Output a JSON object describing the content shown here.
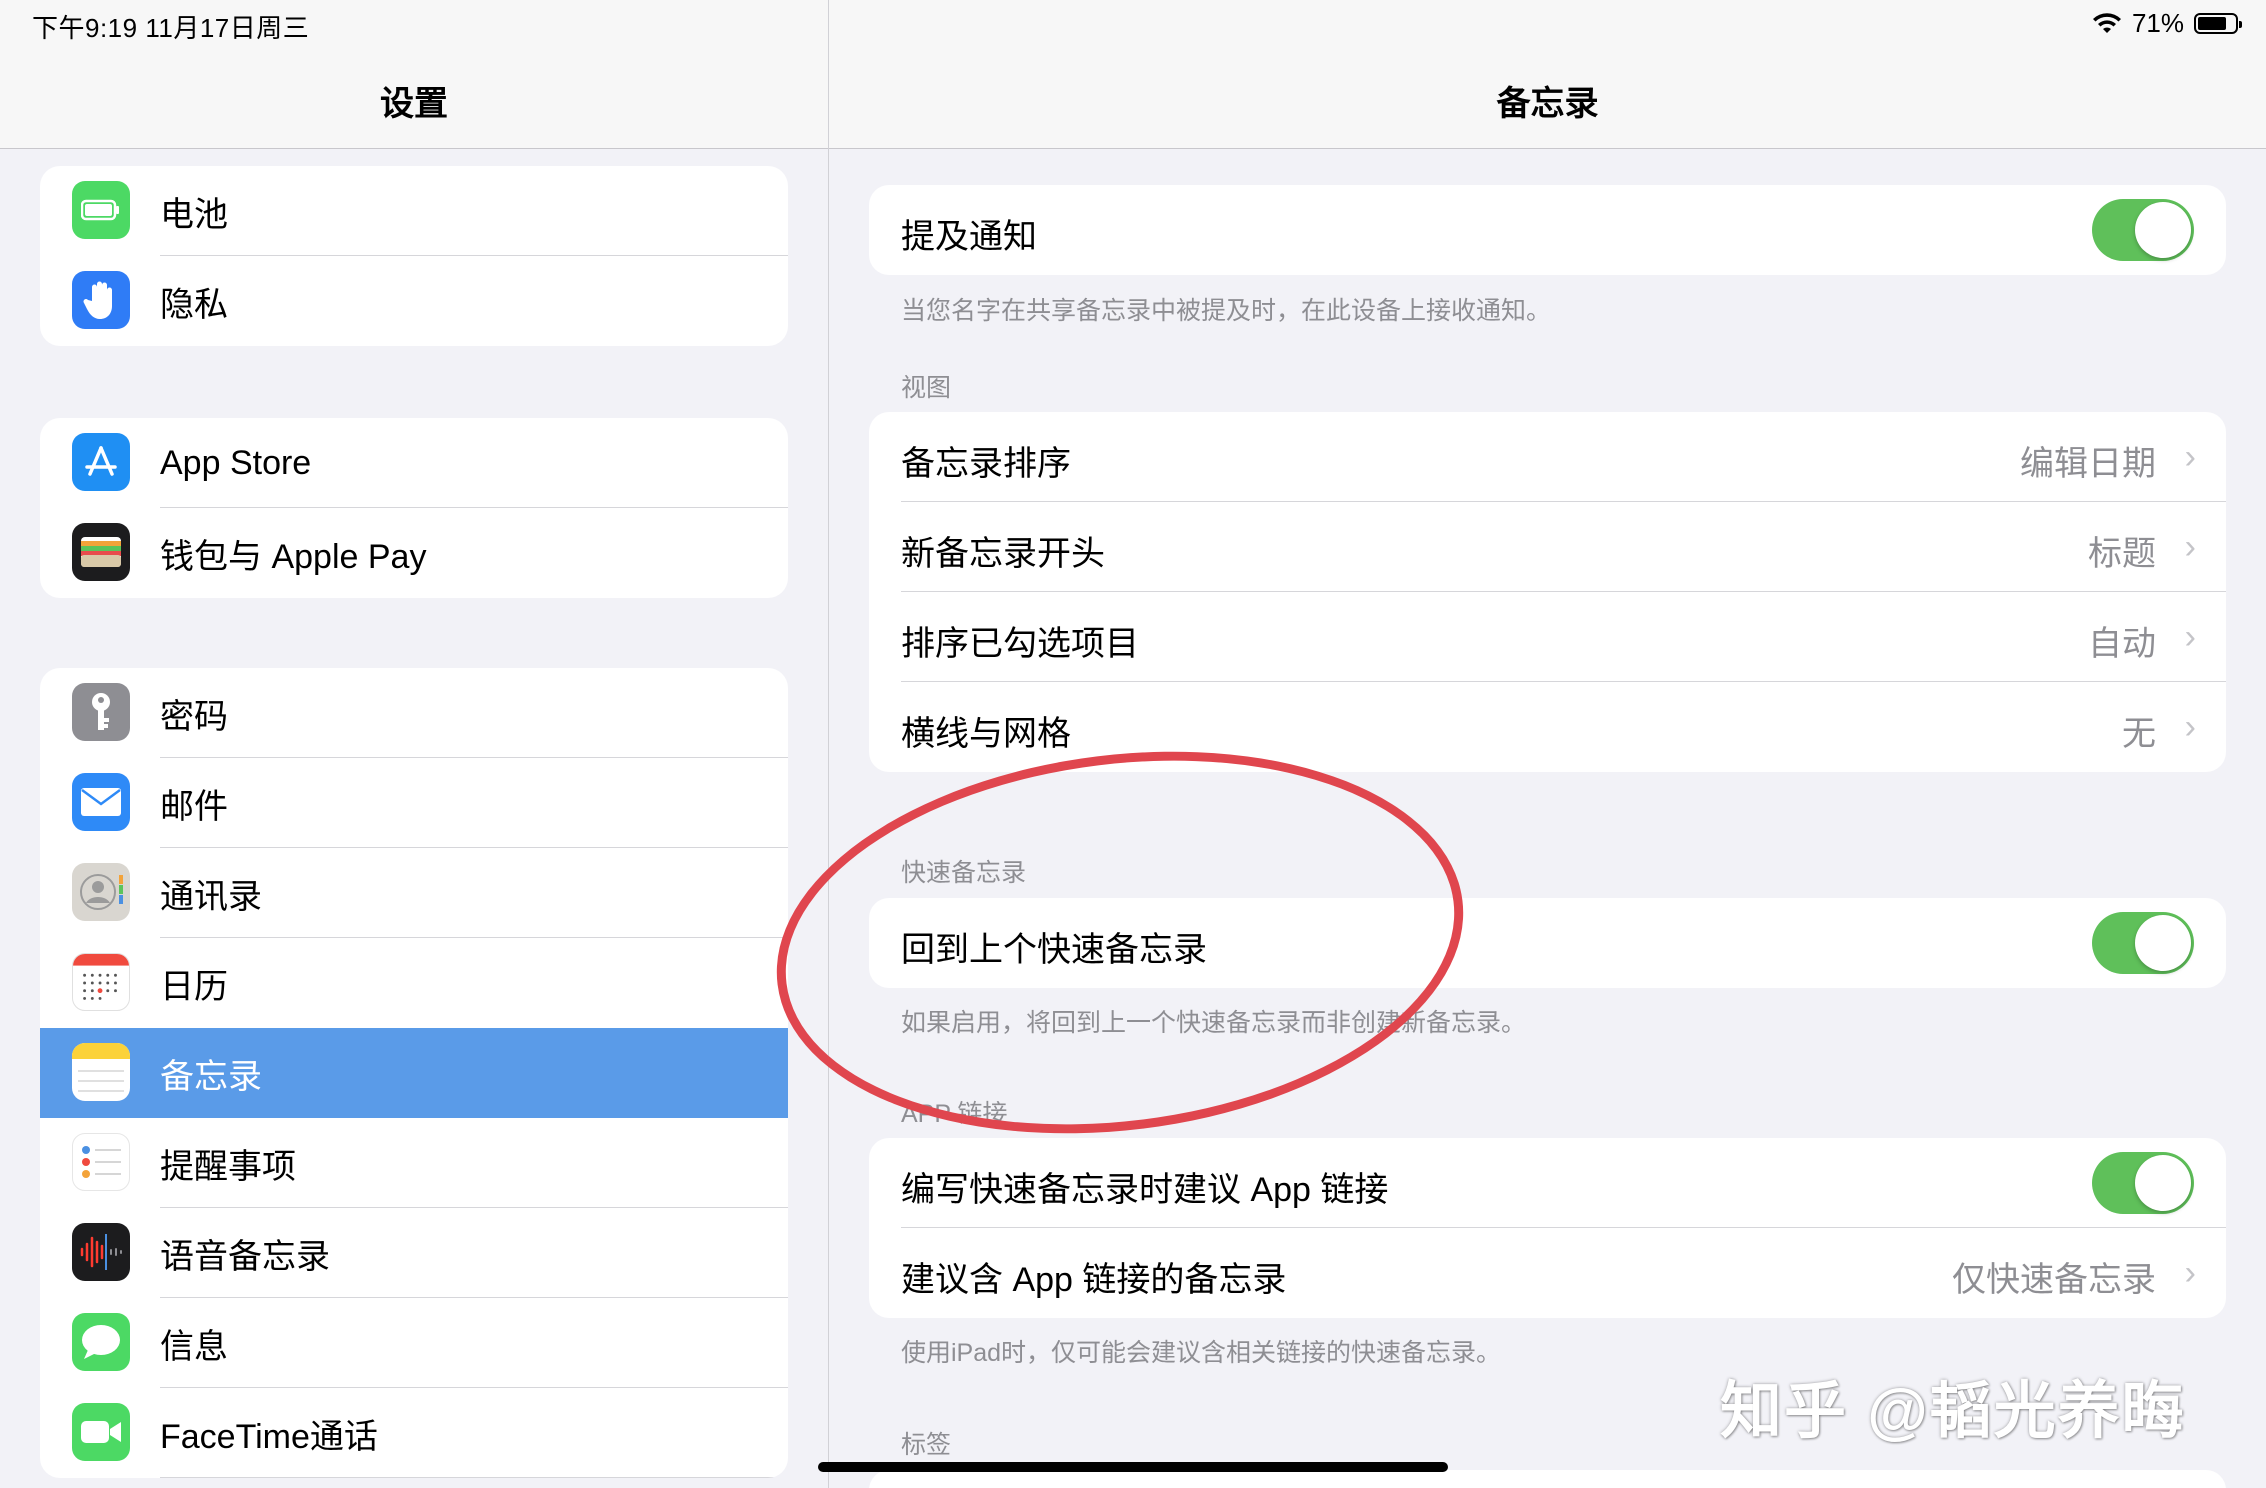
{
  "status_bar": {
    "time": "下午9:19   11月17日周三",
    "battery": "71%"
  },
  "left_pane": {
    "title": "设置",
    "groups": [
      [
        {
          "label": "电池",
          "icon": "battery-icon"
        },
        {
          "label": "隐私",
          "icon": "privacy-hand-icon"
        }
      ],
      [
        {
          "label": "App Store",
          "icon": "app-store-icon"
        },
        {
          "label": "钱包与 Apple Pay",
          "icon": "wallet-icon"
        }
      ],
      [
        {
          "label": "密码",
          "icon": "key-icon"
        },
        {
          "label": "邮件",
          "icon": "mail-icon"
        },
        {
          "label": "通讯录",
          "icon": "contacts-icon"
        },
        {
          "label": "日历",
          "icon": "calendar-icon"
        },
        {
          "label": "备忘录",
          "icon": "notes-icon",
          "selected": true
        },
        {
          "label": "提醒事项",
          "icon": "reminders-icon"
        },
        {
          "label": "语音备忘录",
          "icon": "voice-memos-icon"
        },
        {
          "label": "信息",
          "icon": "messages-icon"
        },
        {
          "label": "FaceTime通话",
          "icon": "facetime-icon"
        }
      ]
    ]
  },
  "right_pane": {
    "title": "备忘录",
    "mention": {
      "label": "提及通知",
      "on": true,
      "footnote": "当您名字在共享备忘录中被提及时，在此设备上接收通知。"
    },
    "view_section": {
      "header": "视图",
      "rows": [
        {
          "label": "备忘录排序",
          "value": "编辑日期"
        },
        {
          "label": "新备忘录开头",
          "value": "标题"
        },
        {
          "label": "排序已勾选项目",
          "value": "自动"
        },
        {
          "label": "横线与网格",
          "value": "无"
        }
      ]
    },
    "quick_note": {
      "header": "快速备忘录",
      "label": "回到上个快速备忘录",
      "on": true,
      "footnote": "如果启用，将回到上一个快速备忘录而非创建新备忘录。"
    },
    "app_links": {
      "header": "APP 链接",
      "toggle_label": "编写快速备忘录时建议 App 链接",
      "on": true,
      "row_label": "建议含 App 链接的备忘录",
      "row_value": "仅快速备忘录",
      "footnote": "使用iPad时，仅可能会建议含相关链接的快速备忘录。"
    },
    "tags_header": "标签"
  },
  "watermark": "知乎 @韬光养晦",
  "colors": {
    "accent": "#5a9be8",
    "toggle_on": "#5fc05a",
    "annotation": "#e0464e"
  }
}
